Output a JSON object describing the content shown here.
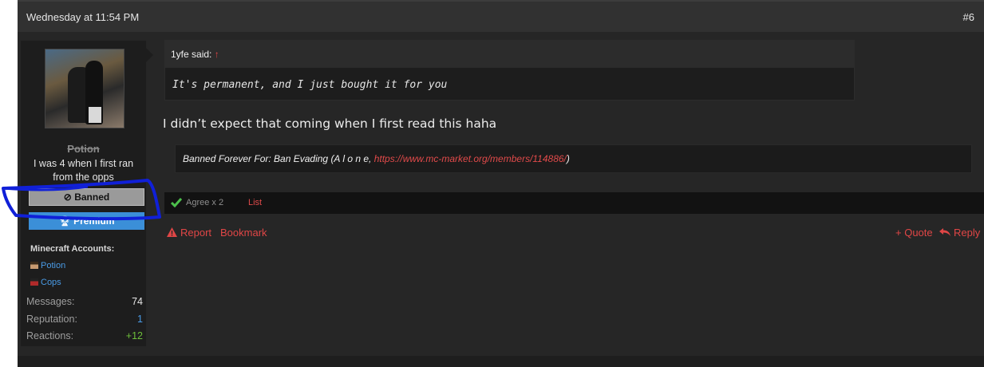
{
  "post": {
    "date": "Wednesday at 11:54 PM",
    "number": "#6",
    "text": "I didn’t expect that coming when I first read this haha",
    "quote": {
      "author": "1yfe said:",
      "arrow": "↑",
      "body": "It's permanent, and I just bought it for you"
    },
    "ban_notice": {
      "prefix": "Banned Forever For: Ban Evading (A l o n e, ",
      "link": "https://www.mc-market.org/members/114886/",
      "suffix": ")"
    },
    "reactions": {
      "text": "Agree x 2",
      "list_label": "List"
    },
    "actions": {
      "report": "Report",
      "bookmark": "Bookmark",
      "quote": "+ Quote",
      "reply": "Reply"
    }
  },
  "user": {
    "username": "Potion",
    "title": "I was 4 when I first ran from the opps",
    "badge_banned": "Banned",
    "badge_premium": "Premium",
    "minecraft_accounts_label": "Minecraft Accounts:",
    "minecraft_accounts": [
      "Potion",
      "Cops"
    ],
    "stats": [
      {
        "label": "Messages:",
        "value": "74",
        "color": "#e6e6e6"
      },
      {
        "label": "Reputation:",
        "value": "1",
        "color": "#4a9be6"
      },
      {
        "label": "Reactions:",
        "value": "+12",
        "color": "#6dbf3a"
      }
    ]
  },
  "colors": {
    "background": "#262626",
    "accent_red": "#e04646",
    "link_blue": "#4a9be6",
    "premium_blue": "#3b8fd8",
    "annotation_blue": "#1020d8"
  }
}
